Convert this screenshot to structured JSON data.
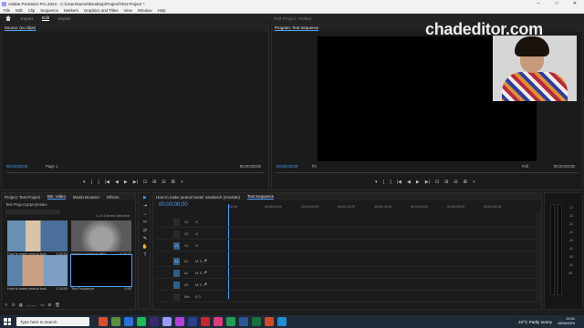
{
  "window": {
    "title": "Adobe Premiere Pro 2024 - C:\\Users\\tomel\\Desktop\\Project\\Test Project *",
    "controls": [
      "–",
      "□",
      "✕"
    ]
  },
  "menu": [
    "File",
    "Edit",
    "Clip",
    "Sequence",
    "Markers",
    "Graphics and Titles",
    "View",
    "Window",
    "Help"
  ],
  "workspace": {
    "tabs": [
      "Import",
      "Edit",
      "Export"
    ],
    "active_tab": "Edit",
    "project_title": "Test Project - Edited"
  },
  "source_monitor": {
    "title": "Source: (no clips)",
    "timecode_in": "00;00;00;00",
    "page": "Page 1",
    "timecode_out": "00;00;00;00",
    "controls": [
      "▾",
      "{",
      "}",
      "|◀",
      "◀",
      "▶",
      "▶|",
      "⊡",
      "⊞",
      "⊟",
      "⊠",
      "+"
    ]
  },
  "program_monitor": {
    "title": "Program: Test Sequence",
    "timecode_in": "00;00;00;00",
    "fit": "Fit",
    "quality": "Full",
    "timecode_out": "00;00;00;00",
    "controls": [
      "▾",
      "{",
      "}",
      "|◀",
      "◀",
      "▶",
      "▶|",
      "⊡",
      "⊞",
      "⊟",
      "⊠",
      "+"
    ]
  },
  "project_panel": {
    "tabs": [
      "Project: Test Project",
      "Bin: Video",
      "Media Browser",
      "Effects"
    ],
    "path": "Test Project.prproj\\Video",
    "items_selected": "1 of 4 items selected",
    "thumbs": [
      {
        "name": "How to make peanut butt...",
        "dur": "1:34:00",
        "kind": "person"
      },
      {
        "name": "making sandwich.MP4",
        "dur": "3:26:23",
        "kind": "bw"
      },
      {
        "name": "How to make peanut butt...",
        "dur": "1:34:00",
        "kind": "person2"
      },
      {
        "name": "Test Sequence",
        "dur": "0:00",
        "kind": "black"
      }
    ]
  },
  "tools": [
    "▶",
    "⇥",
    "↔",
    "✂",
    "⇄",
    "✎",
    "✋",
    "T"
  ],
  "timeline": {
    "tabs": [
      "How to make peanut butter sandwich (resolute)",
      "Test Sequence"
    ],
    "active_tab": "Test Sequence",
    "timecode": "00;00;00;00",
    "ticks": [
      ":00:00",
      "00;00;04;29",
      "00;00;09;29",
      "00;00;14;29",
      "00;00;19;29",
      "00;00;24;29",
      "00;00;29;29",
      "00;00;34;28"
    ],
    "tracks": [
      {
        "name": "V3",
        "lbl": "",
        "ic": "⊙"
      },
      {
        "name": "V2",
        "lbl": "",
        "ic": "⊙"
      },
      {
        "name": "V1",
        "lbl": "V1",
        "ic": "⊙"
      },
      {
        "name": "A1",
        "lbl": "A1",
        "ic": "M S 🎤"
      },
      {
        "name": "A2",
        "lbl": "",
        "ic": "M S 🎤"
      },
      {
        "name": "A3",
        "lbl": "",
        "ic": "M S 🎤"
      },
      {
        "name": "Mix",
        "lbl": "",
        "ic": "0.0"
      }
    ]
  },
  "meters": {
    "scale": [
      "-12",
      "-18",
      "-24",
      "-30",
      "-36",
      "-42",
      "-48",
      "-54",
      "dB"
    ]
  },
  "brand": "chadeditor.com",
  "taskbar": {
    "search": "Type here to search",
    "weather": "22°C  Partly sunny",
    "time": "20:01",
    "date": "15/06/2024",
    "apps": [
      "#d94f2b",
      "#5b8f3a",
      "#2b6fd9",
      "#1db954",
      "#3b2a6b",
      "#9999ff",
      "#b43fdb",
      "#2b3f8a",
      "#c4262e",
      "#e03a7e",
      "#1f9e53",
      "#2b5797",
      "#1d6f42",
      "#d04b26",
      "#1f8bd1"
    ]
  }
}
